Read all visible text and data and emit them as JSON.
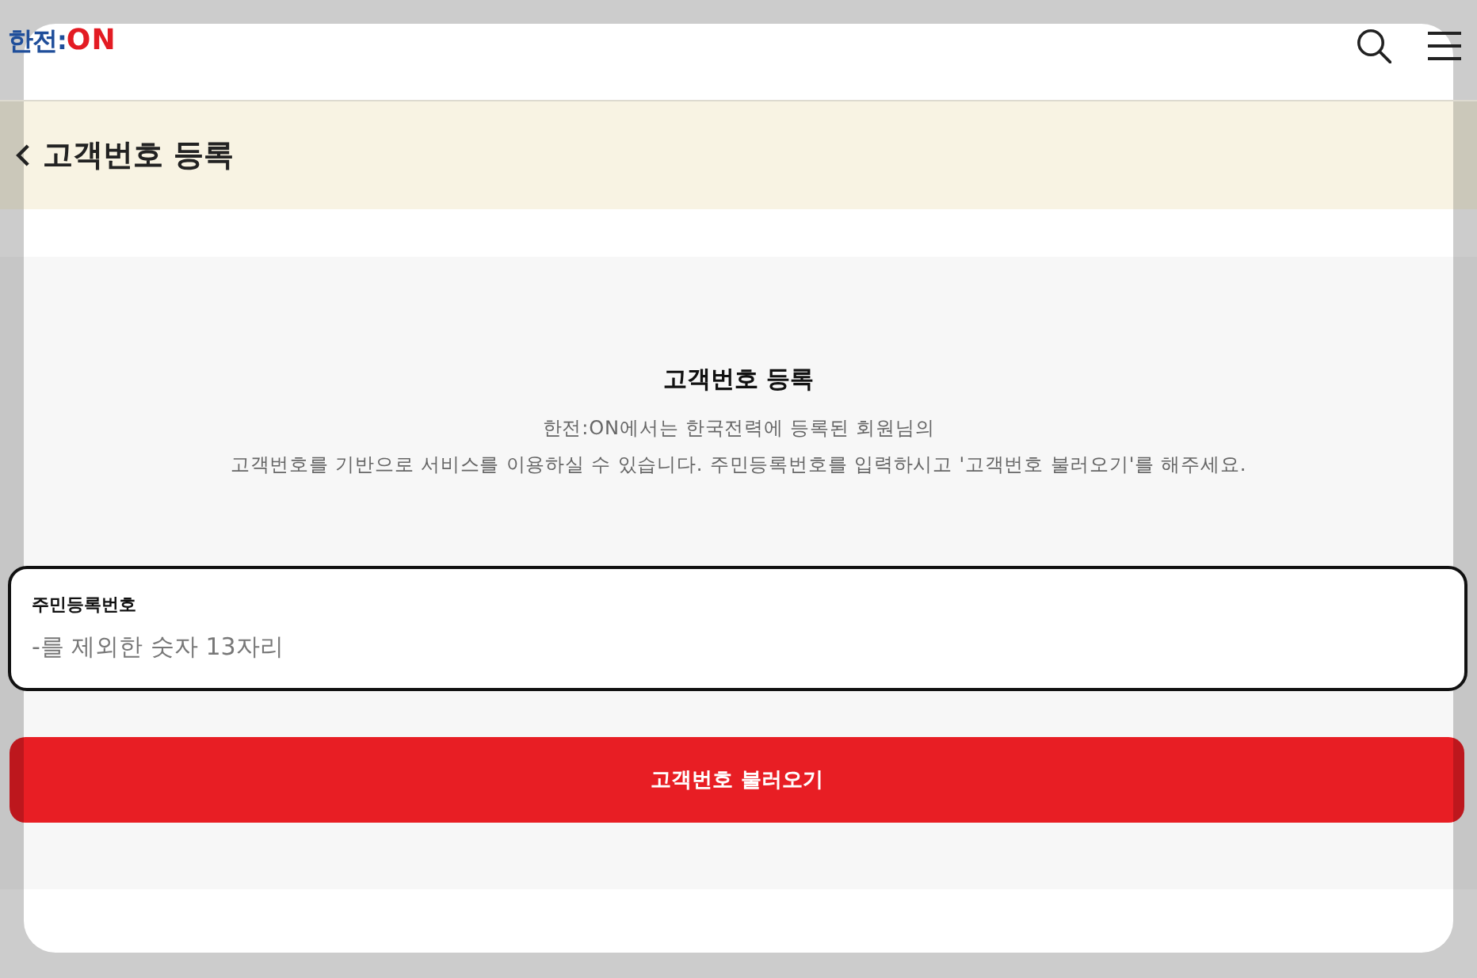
{
  "header": {
    "logo": [
      {
        "text": "한전:",
        "color": "#1f4e9a"
      },
      {
        "text": "ON",
        "color": "#e31b23"
      }
    ]
  },
  "title_bar": {
    "title": "고객번호 등록"
  },
  "section": {
    "heading": "고객번호 등록",
    "description": [
      "한전:ON에서는 한국전력에 등록된 회원님의",
      "고객번호를 기반으로 서비스를 이용하실 수 있습니다. 주민등록번호를 입력하시고 '고객번호 불러오기'를 해주세요."
    ]
  },
  "field": {
    "label": "주민등록번호",
    "placeholder": "-를 제외한 숫자 13자리"
  },
  "button": {
    "label": "고객번호 불러오기"
  }
}
